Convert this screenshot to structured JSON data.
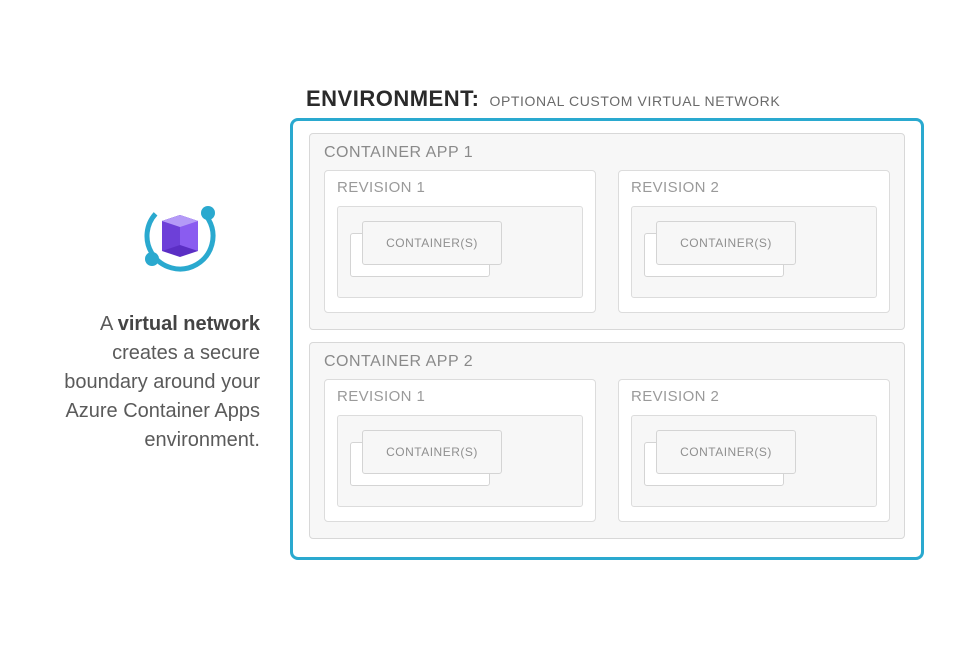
{
  "description_prefix": "A ",
  "description_bold": "virtual network",
  "description_rest": " creates a secure boundary around your Azure Container Apps environment.",
  "environment": {
    "label": "ENVIRONMENT:",
    "subtitle": "OPTIONAL CUSTOM VIRTUAL NETWORK",
    "apps": [
      {
        "title": "CONTAINER APP 1",
        "revisions": [
          {
            "title": "REVISION 1",
            "container_label": "CONTAINER(S)"
          },
          {
            "title": "REVISION 2",
            "container_label": "CONTAINER(S)"
          }
        ]
      },
      {
        "title": "CONTAINER APP 2",
        "revisions": [
          {
            "title": "REVISION 1",
            "container_label": "CONTAINER(S)"
          },
          {
            "title": "REVISION 2",
            "container_label": "CONTAINER(S)"
          }
        ]
      }
    ]
  },
  "colors": {
    "env_border": "#2aa9cf",
    "box_border": "#d8d8d8",
    "icon_purple": "#7b3fe4",
    "icon_teal": "#2aa9cf"
  }
}
